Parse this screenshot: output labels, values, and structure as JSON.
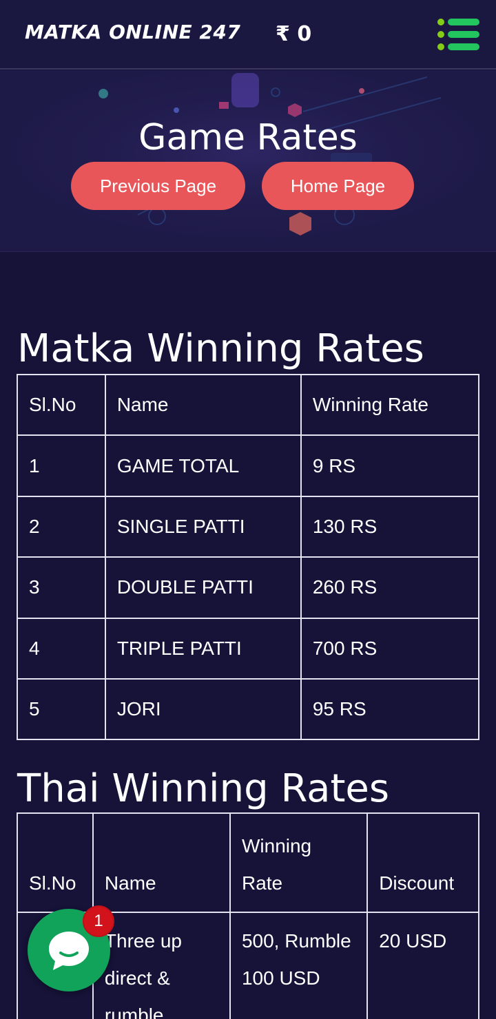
{
  "header": {
    "brand": "MATKA ONLINE 247",
    "balance": "₹ 0",
    "menu_icon": "menu-list-icon"
  },
  "banner": {
    "title": "Game Rates",
    "previous_label": "Previous Page",
    "home_label": "Home Page"
  },
  "matka": {
    "title": "Matka Winning Rates",
    "headers": [
      "Sl.No",
      "Name",
      "Winning Rate"
    ],
    "rows": [
      [
        "1",
        "GAME TOTAL",
        "9 RS"
      ],
      [
        "2",
        "SINGLE PATTI",
        "130 RS"
      ],
      [
        "3",
        "DOUBLE PATTI",
        "260 RS"
      ],
      [
        "4",
        "TRIPLE PATTI",
        "700 RS"
      ],
      [
        "5",
        "JORI",
        "95 RS"
      ]
    ]
  },
  "thai": {
    "title": "Thai Winning Rates",
    "headers": [
      "Sl.No",
      "Name",
      "Winning Rate",
      "Discount"
    ],
    "rows": [
      [
        "",
        "Three up direct & rumble",
        "500, Rumble 100 USD",
        "20 USD"
      ]
    ]
  },
  "chat": {
    "badge": "1",
    "icon": "chat-bubble-icon"
  },
  "colors": {
    "background": "#161238",
    "header": "#1a1740",
    "pill": "#e8565a",
    "chat": "#11a35a",
    "badge": "#d3131c",
    "menu_green": "#22c55e",
    "menu_lime": "#84cc16"
  }
}
